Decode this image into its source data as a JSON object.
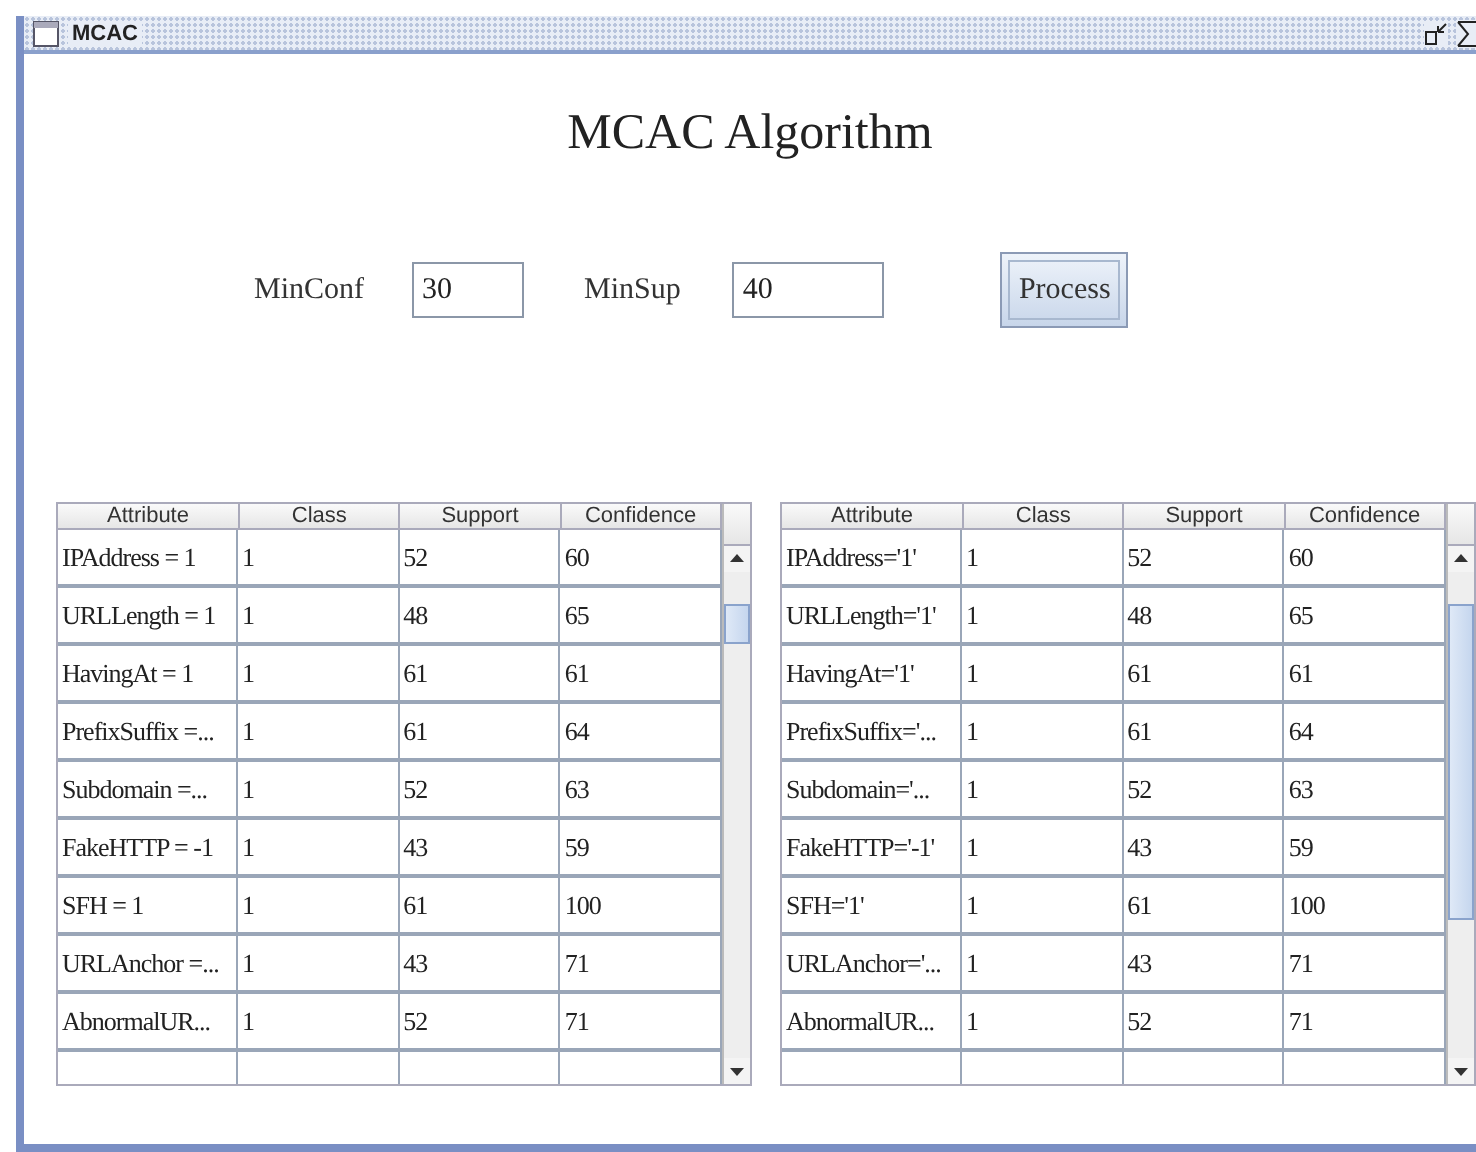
{
  "window": {
    "title": "MCAC"
  },
  "heading": "MCAC Algorithm",
  "form": {
    "fields": [
      {
        "label": "MinConf",
        "value": "30"
      },
      {
        "label": "MinSup",
        "value": "40"
      }
    ],
    "button": "Process"
  },
  "tables": [
    {
      "columns": [
        "Attribute",
        "Class",
        "Support",
        "Confidence"
      ],
      "rows": [
        [
          "IPAddress = 1",
          "1",
          "52",
          "60"
        ],
        [
          "URLLength = 1",
          "1",
          "48",
          "65"
        ],
        [
          "HavingAt = 1",
          "1",
          "61",
          "61"
        ],
        [
          "PrefixSuffix =...",
          "1",
          "61",
          "64"
        ],
        [
          "Subdomain =...",
          "1",
          "52",
          "63"
        ],
        [
          "FakeHTTP = -1",
          "1",
          "43",
          "59"
        ],
        [
          "SFH = 1",
          "1",
          "61",
          "100"
        ],
        [
          "URLAnchor =...",
          "1",
          "43",
          "71"
        ],
        [
          "AbnormalUR...",
          "1",
          "52",
          "71"
        ]
      ]
    },
    {
      "columns": [
        "Attribute",
        "Class",
        "Support",
        "Confidence"
      ],
      "rows": [
        [
          "IPAddress='1'",
          "1",
          "52",
          "60"
        ],
        [
          "URLLength='1'",
          "1",
          "48",
          "65"
        ],
        [
          "HavingAt='1'",
          "1",
          "61",
          "61"
        ],
        [
          "PrefixSuffix='...",
          "1",
          "61",
          "64"
        ],
        [
          "Subdomain='...",
          "1",
          "52",
          "63"
        ],
        [
          "FakeHTTP='-1'",
          "1",
          "43",
          "59"
        ],
        [
          "SFH='1'",
          "1",
          "61",
          "100"
        ],
        [
          "URLAnchor='...",
          "1",
          "43",
          "71"
        ],
        [
          "AbnormalUR...",
          "1",
          "52",
          "71"
        ]
      ]
    }
  ]
}
